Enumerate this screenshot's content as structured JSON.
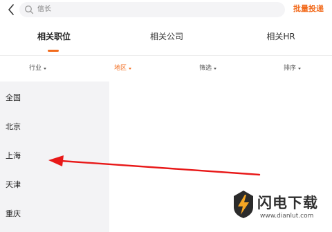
{
  "header": {
    "back_icon": "chevron-left-icon",
    "search_placeholder": "信长",
    "search_icon": "search-icon",
    "batch_apply_label": "批量投递"
  },
  "tabs": [
    {
      "label": "相关职位",
      "active": true
    },
    {
      "label": "相关公司",
      "active": false
    },
    {
      "label": "相关HR",
      "active": false
    }
  ],
  "filters": [
    {
      "label": "行业",
      "active": false
    },
    {
      "label": "地区",
      "active": true
    },
    {
      "label": "筛选",
      "active": false
    },
    {
      "label": "排序",
      "active": false
    }
  ],
  "regions": [
    "全国",
    "北京",
    "上海",
    "天津",
    "重庆"
  ],
  "watermark": {
    "text": "闪电下载",
    "url": "www.dianlut.com"
  },
  "colors": {
    "accent": "#f26b1d",
    "annotation_arrow": "#e81818"
  }
}
